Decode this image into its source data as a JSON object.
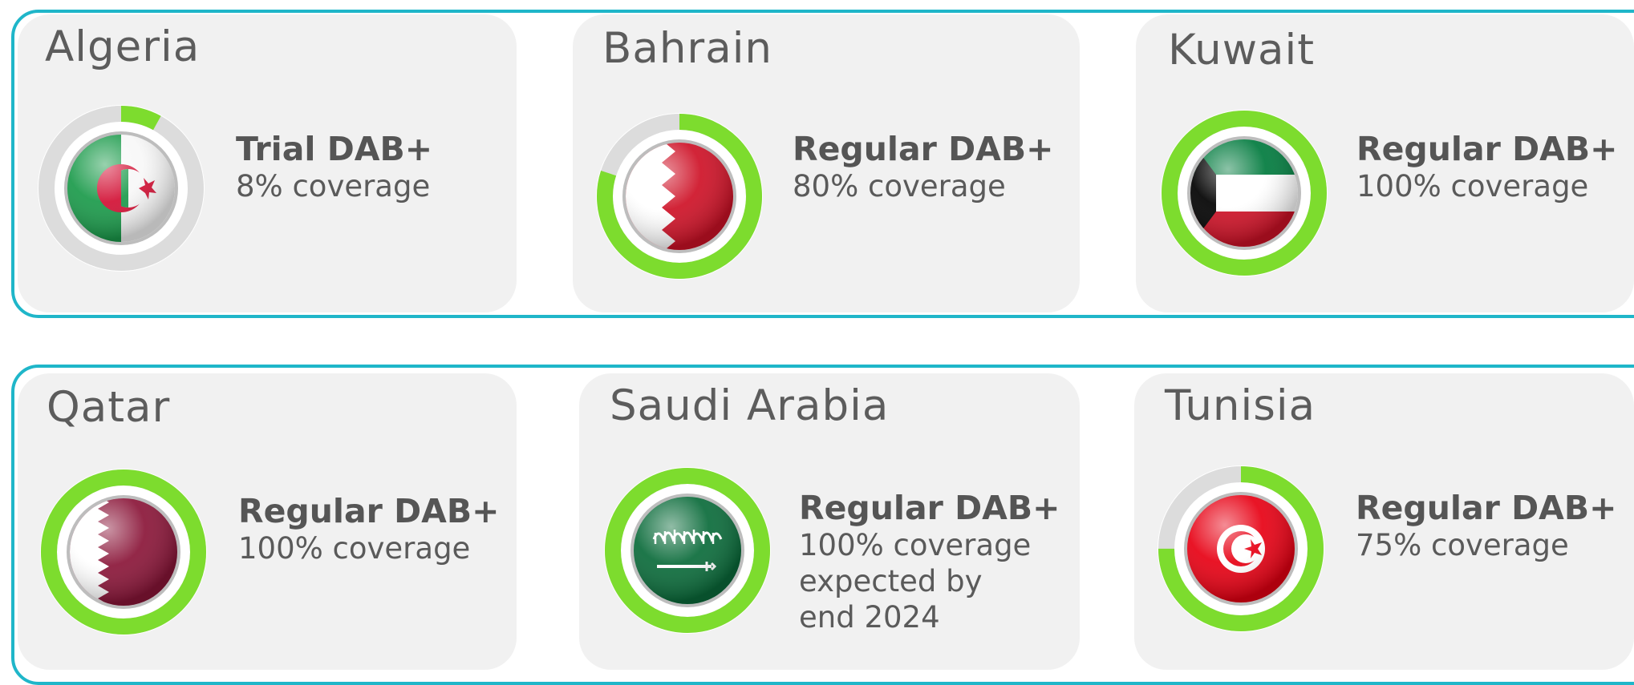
{
  "colors": {
    "frame": "#1fb6c9",
    "card_bg": "#f1f1f1",
    "gauge_fill": "#7ddc2e",
    "gauge_track": "#dcdcdc",
    "text": "#5a5a5a"
  },
  "rows": [
    {
      "countries": [
        {
          "name": "Algeria",
          "status": "Trial DAB+",
          "coverage_text": "8% coverage",
          "coverage_pct": 8,
          "flag": "algeria-flag-icon"
        },
        {
          "name": "Bahrain",
          "status": "Regular DAB+",
          "coverage_text": "80% coverage",
          "coverage_pct": 80,
          "flag": "bahrain-flag-icon"
        },
        {
          "name": "Kuwait",
          "status": "Regular DAB+",
          "coverage_text": "100% coverage",
          "coverage_pct": 100,
          "flag": "kuwait-flag-icon"
        }
      ]
    },
    {
      "countries": [
        {
          "name": "Qatar",
          "status": "Regular DAB+",
          "coverage_text": "100% coverage",
          "coverage_pct": 100,
          "flag": "qatar-flag-icon"
        },
        {
          "name": "Saudi Arabia",
          "status": "Regular DAB+",
          "coverage_lines": [
            "100% coverage",
            "expected by",
            "end 2024"
          ],
          "coverage_pct": 100,
          "flag": "saudi-arabia-flag-icon"
        },
        {
          "name": "Tunisia",
          "status": "Regular DAB+",
          "coverage_text": "75% coverage",
          "coverage_pct": 75,
          "flag": "tunisia-flag-icon"
        }
      ]
    }
  ]
}
